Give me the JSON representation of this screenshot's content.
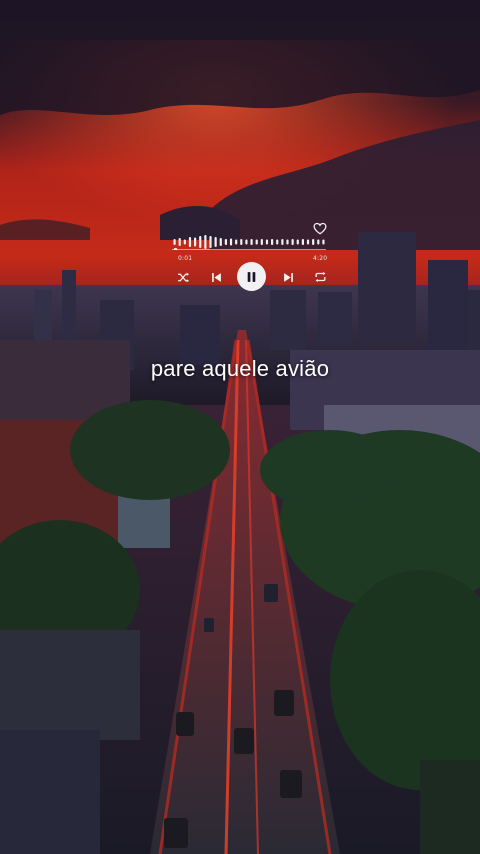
{
  "player": {
    "elapsed_time": "0:01",
    "total_time": "4:20",
    "progress": 0.01,
    "liked": false,
    "state": "playing"
  },
  "lyric": {
    "line": "pare aquele avião"
  },
  "colors": {
    "sky_red": "#c8241a",
    "sky_dark": "#1b1426",
    "road_glow": "#d23a22",
    "foliage": "#1f3a22",
    "controls": "#f2f0f3"
  },
  "icons": {
    "shuffle": "shuffle-icon",
    "previous": "skip-previous-icon",
    "play_pause": "pause-icon",
    "next": "skip-next-icon",
    "repeat": "repeat-icon",
    "like": "heart-icon"
  }
}
